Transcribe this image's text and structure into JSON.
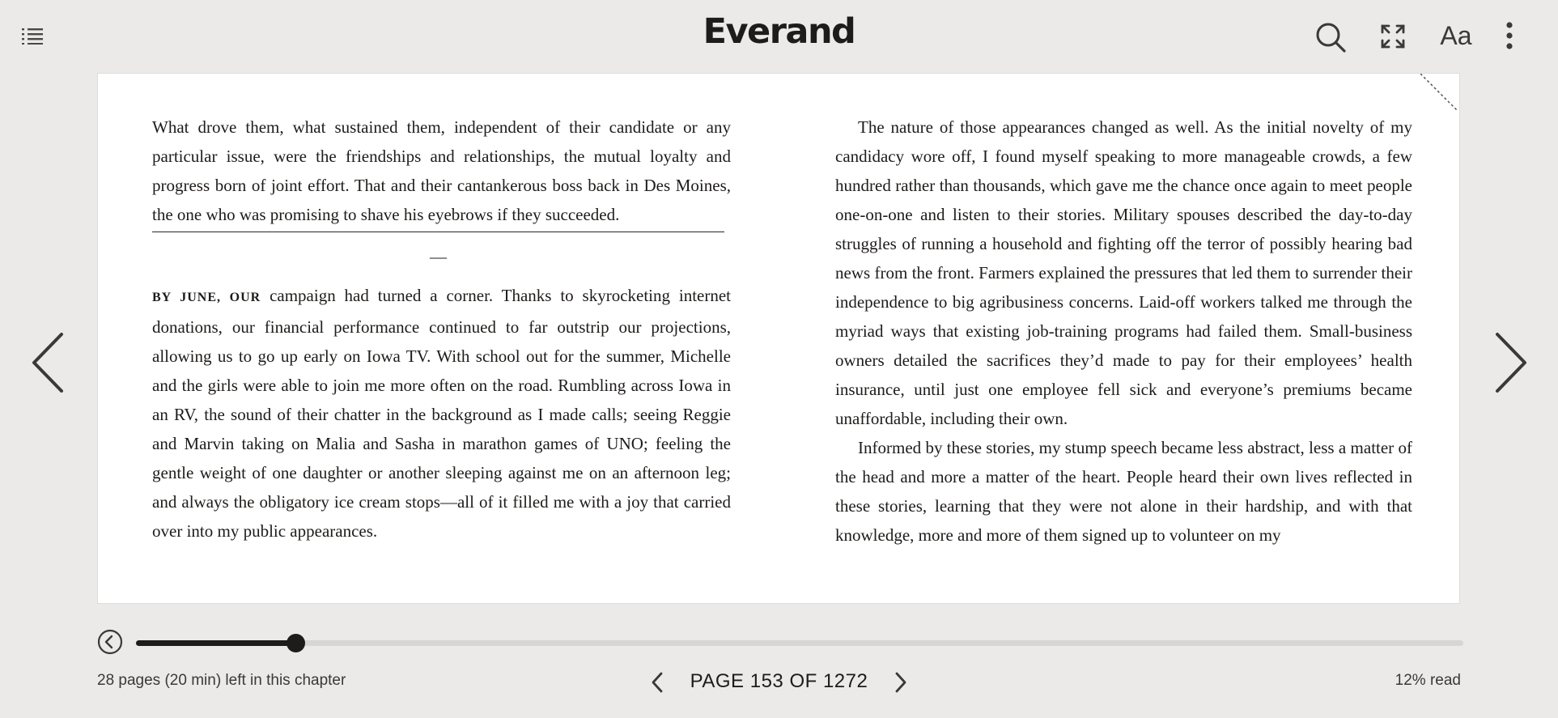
{
  "app": {
    "brand": "Everand"
  },
  "toolbar": {
    "toc_icon": "list-icon",
    "search_icon": "search-icon",
    "fullscreen_icon": "expand-icon",
    "font_label": "Aa",
    "more_icon": "more-vertical-icon"
  },
  "book": {
    "left_page": {
      "paragraph_1": "What drove them, what sustained them, independent of their candidate or any particular issue, were the friendships and relationships, the mutual loyalty and progress born of joint effort. That and their cantankerous boss back in Des Moines, the one who was promising to shave his eyebrows if they succeeded.",
      "section_break": "—",
      "lead_in": "BY JUNE, OUR",
      "paragraph_2": " campaign had turned a corner. Thanks to skyrocketing internet donations, our financial performance continued to far outstrip our projections, allowing us to go up early on Iowa TV. With school out for the summer, Michelle and the girls were able to join me more often on the road. Rumbling across Iowa in an RV, the sound of their chatter in the background as I made calls; seeing Reggie and Marvin taking on Malia and Sasha in marathon games of UNO; feeling the gentle weight of one daughter or another sleeping against me on an afternoon leg; and always the obligatory ice cream stops—all of it filled me with a joy that carried over into my public appearances."
    },
    "right_page": {
      "paragraph_1": "The nature of those appearances changed as well. As the initial novelty of my candidacy wore off, I found myself speaking to more manageable crowds, a few hundred rather than thousands, which gave me the chance once again to meet people one-on-one and listen to their stories. Military spouses described the day-to-day struggles of running a household and fighting off the terror of possibly hearing bad news from the front. Farmers explained the pressures that led them to surrender their independence to big agribusiness concerns. Laid-off workers talked me through the myriad ways that existing job-training programs had failed them. Small-business owners detailed the sacrifices they’d made to pay for their employees’ health insurance, until just one employee fell sick and everyone’s premiums became unaffordable, including their own.",
      "paragraph_2": "Informed by these stories, my stump speech became less abstract, less a matter of the head and more a matter of the heart. People heard their own lives reflected in these stories, learning that they were not alone in their hardship, and with that knowledge, more and more of them signed up to volunteer on my"
    }
  },
  "navigation": {
    "prev_page_icon": "chevron-left-icon",
    "next_page_icon": "chevron-right-icon",
    "back_icon": "circle-back-icon"
  },
  "progress": {
    "fraction": 0.12,
    "chapter_remaining": "28 pages (20 min) left in this chapter",
    "page_indicator": "PAGE 153 OF 1272",
    "percent_read": "12% read"
  },
  "colors": {
    "background": "#ebeae8",
    "page": "#ffffff",
    "text": "#1e1c1a",
    "track": "#d8d6d3"
  }
}
